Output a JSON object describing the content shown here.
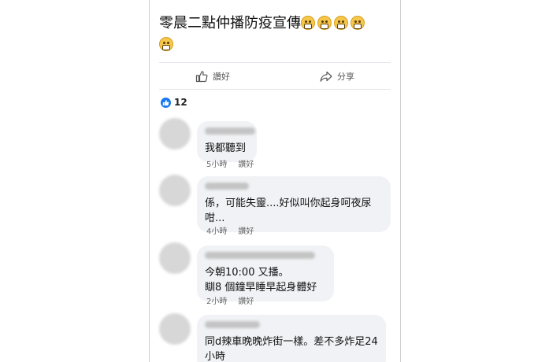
{
  "post": {
    "text": "零晨二點仲播防疫宣傳",
    "emoji_icon": "grimacing-face-icon",
    "emoji_count": 5
  },
  "actions": {
    "like_label": "讚好",
    "share_label": "分享"
  },
  "reactions": {
    "icon": "thumbs-up-icon",
    "count": "12",
    "color": "#1877f2"
  },
  "comments": [
    {
      "lines": [
        "我都聽到"
      ],
      "time": "5小時",
      "like_label": "讚好"
    },
    {
      "lines": [
        "係，可能失靈....好似叫你起身呵夜尿",
        "咁..."
      ],
      "time": "4小時",
      "like_label": "讚好"
    },
    {
      "lines": [
        "今朝10:00 又播。",
        "瞓8 個鐘早睡早起身體好"
      ],
      "time": "2小時",
      "like_label": "讚好"
    },
    {
      "lines": [
        "同d辣車晚晚炸街一樣。差不多炸足24",
        "小時"
      ]
    }
  ]
}
